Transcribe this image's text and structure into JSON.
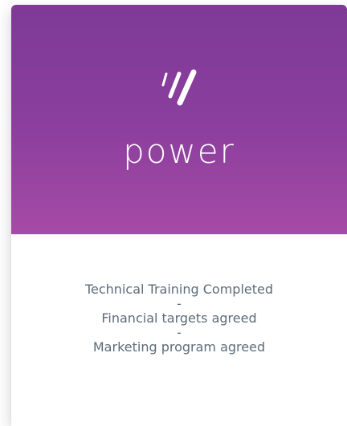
{
  "card": {
    "brand": "power",
    "gradient_top": "#7e3a96",
    "gradient_bottom": "#a64aa6",
    "logo_icon": "power-slashes-icon"
  },
  "details": {
    "line1": "Technical Training Completed",
    "sep1": "-",
    "line2": "Financial targets agreed",
    "sep2": "-",
    "line3": "Marketing program agreed"
  }
}
